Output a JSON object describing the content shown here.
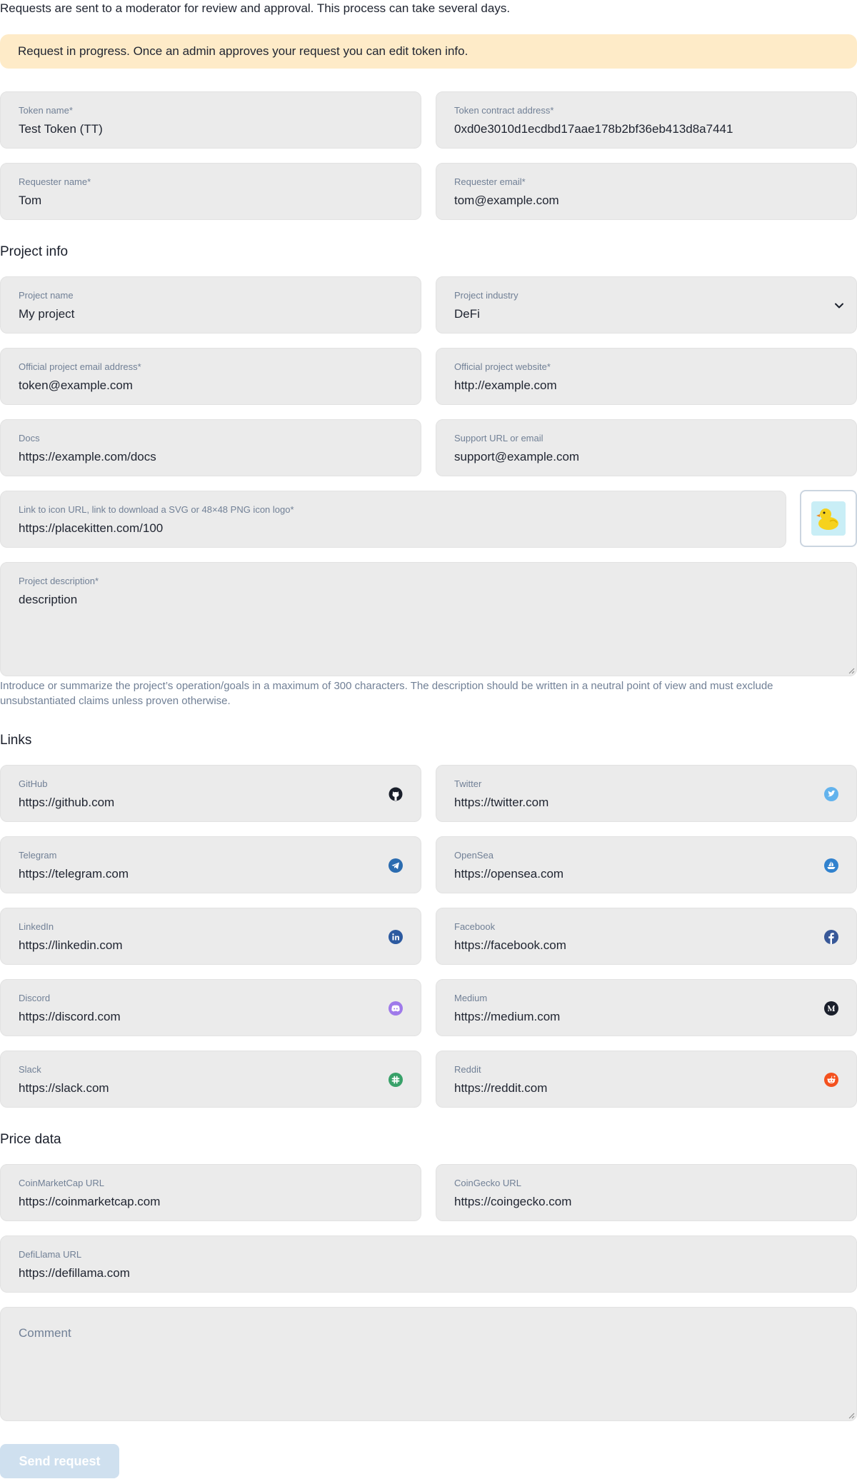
{
  "intro": "Requests are sent to a moderator for review and approval. This process can take several days.",
  "alert": "Request in progress. Once an admin approves your request you can edit token info.",
  "token": {
    "name": {
      "label": "Token name*",
      "value": "Test Token (TT)"
    },
    "address": {
      "label": "Token contract address*",
      "value": "0xd0e3010d1ecdbd17aae178b2bf36eb413d8a7441"
    },
    "requester_name": {
      "label": "Requester name*",
      "value": "Tom"
    },
    "requester_email": {
      "label": "Requester email*",
      "value": "tom@example.com"
    }
  },
  "project": {
    "heading": "Project info",
    "name": {
      "label": "Project name",
      "value": "My project"
    },
    "industry": {
      "label": "Project industry",
      "value": "DeFi"
    },
    "email": {
      "label": "Official project email address*",
      "value": "token@example.com"
    },
    "website": {
      "label": "Official project website*",
      "value": "http://example.com"
    },
    "docs": {
      "label": "Docs",
      "value": "https://example.com/docs"
    },
    "support": {
      "label": "Support URL or email",
      "value": "support@example.com"
    },
    "icon_url": {
      "label": "Link to icon URL, link to download a SVG or 48×48 PNG icon logo*",
      "value": "https://placekitten.com/100"
    },
    "description": {
      "label": "Project description*",
      "value": "description"
    },
    "hint": "Introduce or summarize the project’s operation/goals in a maximum of 300 characters. The description should be written in a neutral point of view and must exclude unsubstantiated claims unless proven otherwise."
  },
  "links": {
    "heading": "Links",
    "github": {
      "label": "GitHub",
      "value": "https://github.com",
      "icon": "github-icon"
    },
    "twitter": {
      "label": "Twitter",
      "value": "https://twitter.com",
      "icon": "twitter-icon"
    },
    "telegram": {
      "label": "Telegram",
      "value": "https://telegram.com",
      "icon": "telegram-icon"
    },
    "opensea": {
      "label": "OpenSea",
      "value": "https://opensea.com",
      "icon": "opensea-icon"
    },
    "linkedin": {
      "label": "LinkedIn",
      "value": "https://linkedin.com",
      "icon": "linkedin-icon"
    },
    "facebook": {
      "label": "Facebook",
      "value": "https://facebook.com",
      "icon": "facebook-icon"
    },
    "discord": {
      "label": "Discord",
      "value": "https://discord.com",
      "icon": "discord-icon"
    },
    "medium": {
      "label": "Medium",
      "value": "https://medium.com",
      "icon": "medium-icon"
    },
    "slack": {
      "label": "Slack",
      "value": "https://slack.com",
      "icon": "slack-icon"
    },
    "reddit": {
      "label": "Reddit",
      "value": "https://reddit.com",
      "icon": "reddit-icon"
    }
  },
  "price": {
    "heading": "Price data",
    "cmc": {
      "label": "CoinMarketCap URL",
      "value": "https://coinmarketcap.com"
    },
    "coingecko": {
      "label": "CoinGecko URL",
      "value": "https://coingecko.com"
    },
    "defillama": {
      "label": "DefiLlama URL",
      "value": "https://defillama.com"
    }
  },
  "comment": {
    "placeholder": "Comment"
  },
  "submit_label": "Send request",
  "colors": {
    "alert_bg": "#feebc8",
    "field_bg": "#ebebeb",
    "label": "#718096",
    "button_disabled": "#cfe0ef",
    "twitter": "#63b3ed",
    "telegram": "#2b6cb0",
    "opensea": "#3182ce",
    "linkedin": "#2c5aa0",
    "facebook": "#385898",
    "discord": "#9f7aea",
    "slack": "#38a169",
    "reddit": "#f4511e"
  }
}
